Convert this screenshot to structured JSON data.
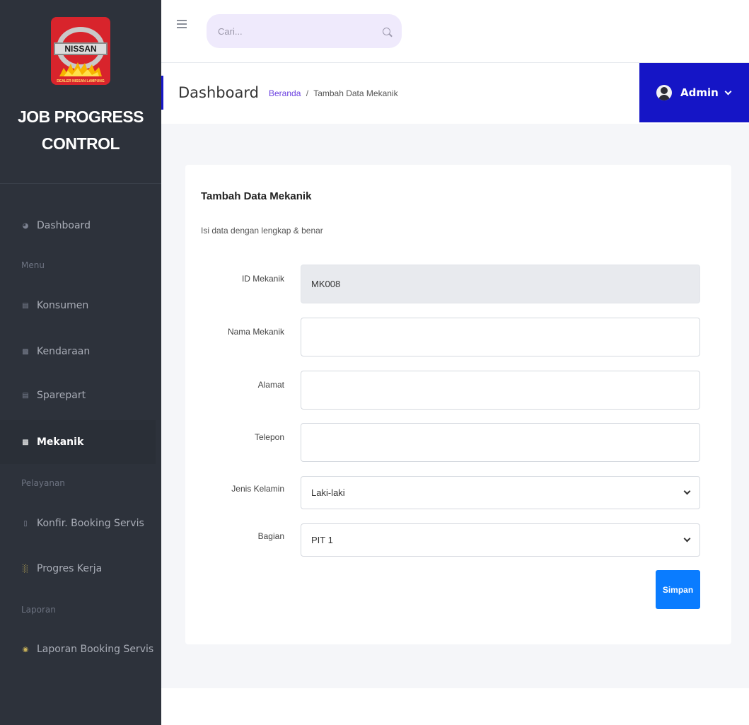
{
  "sidebar": {
    "logo": {
      "brand_text": "NISSAN",
      "caption": "DEALER NISSAN LAMPUNG"
    },
    "app_title_line1": "JOB PROGRESS",
    "app_title_line2": "CONTROL",
    "items": [
      {
        "label": "Dashboard",
        "icon": "gauge-icon"
      },
      {
        "label": "Konsumen",
        "icon": "address-card-icon"
      },
      {
        "label": "Kendaraan",
        "icon": "id-card-icon"
      },
      {
        "label": "Sparepart",
        "icon": "address-card-icon"
      },
      {
        "label": "Mekanik",
        "icon": "id-card-icon",
        "active": true
      },
      {
        "label": "Konfir. Booking Servis",
        "icon": "file-icon"
      },
      {
        "label": "Progres Kerja",
        "icon": "bar-chart-icon"
      },
      {
        "label": "Laporan Booking Servis",
        "icon": "print-icon"
      }
    ],
    "headings": {
      "menu": "Menu",
      "pelayanan": "Pelayanan",
      "laporan": "Laporan"
    }
  },
  "topbar": {
    "search_placeholder": "Cari..."
  },
  "header": {
    "title": "Dashboard",
    "breadcrumb_home": "Beranda",
    "breadcrumb_sep": "/",
    "breadcrumb_current": "Tambah Data Mekanik",
    "user_name": "Admin"
  },
  "form": {
    "title": "Tambah Data Mekanik",
    "subtitle": "Isi data dengan lengkap & benar",
    "fields": {
      "id": {
        "label": "ID Mekanik",
        "value": "MK008"
      },
      "nama": {
        "label": "Nama Mekanik",
        "value": ""
      },
      "alamat": {
        "label": "Alamat",
        "value": ""
      },
      "telepon": {
        "label": "Telepon",
        "value": ""
      },
      "jenis_kelamin": {
        "label": "Jenis Kelamin",
        "value": "Laki-laki"
      },
      "bagian": {
        "label": "Bagian",
        "value": "PIT 1"
      }
    },
    "submit_label": "Simpan"
  },
  "colors": {
    "sidebar_bg": "#2d323b",
    "accent_blue": "#1515c6",
    "button_blue": "#0a7cff",
    "breadcrumb_link": "#6a3fe0",
    "search_bg": "#efeafc"
  }
}
